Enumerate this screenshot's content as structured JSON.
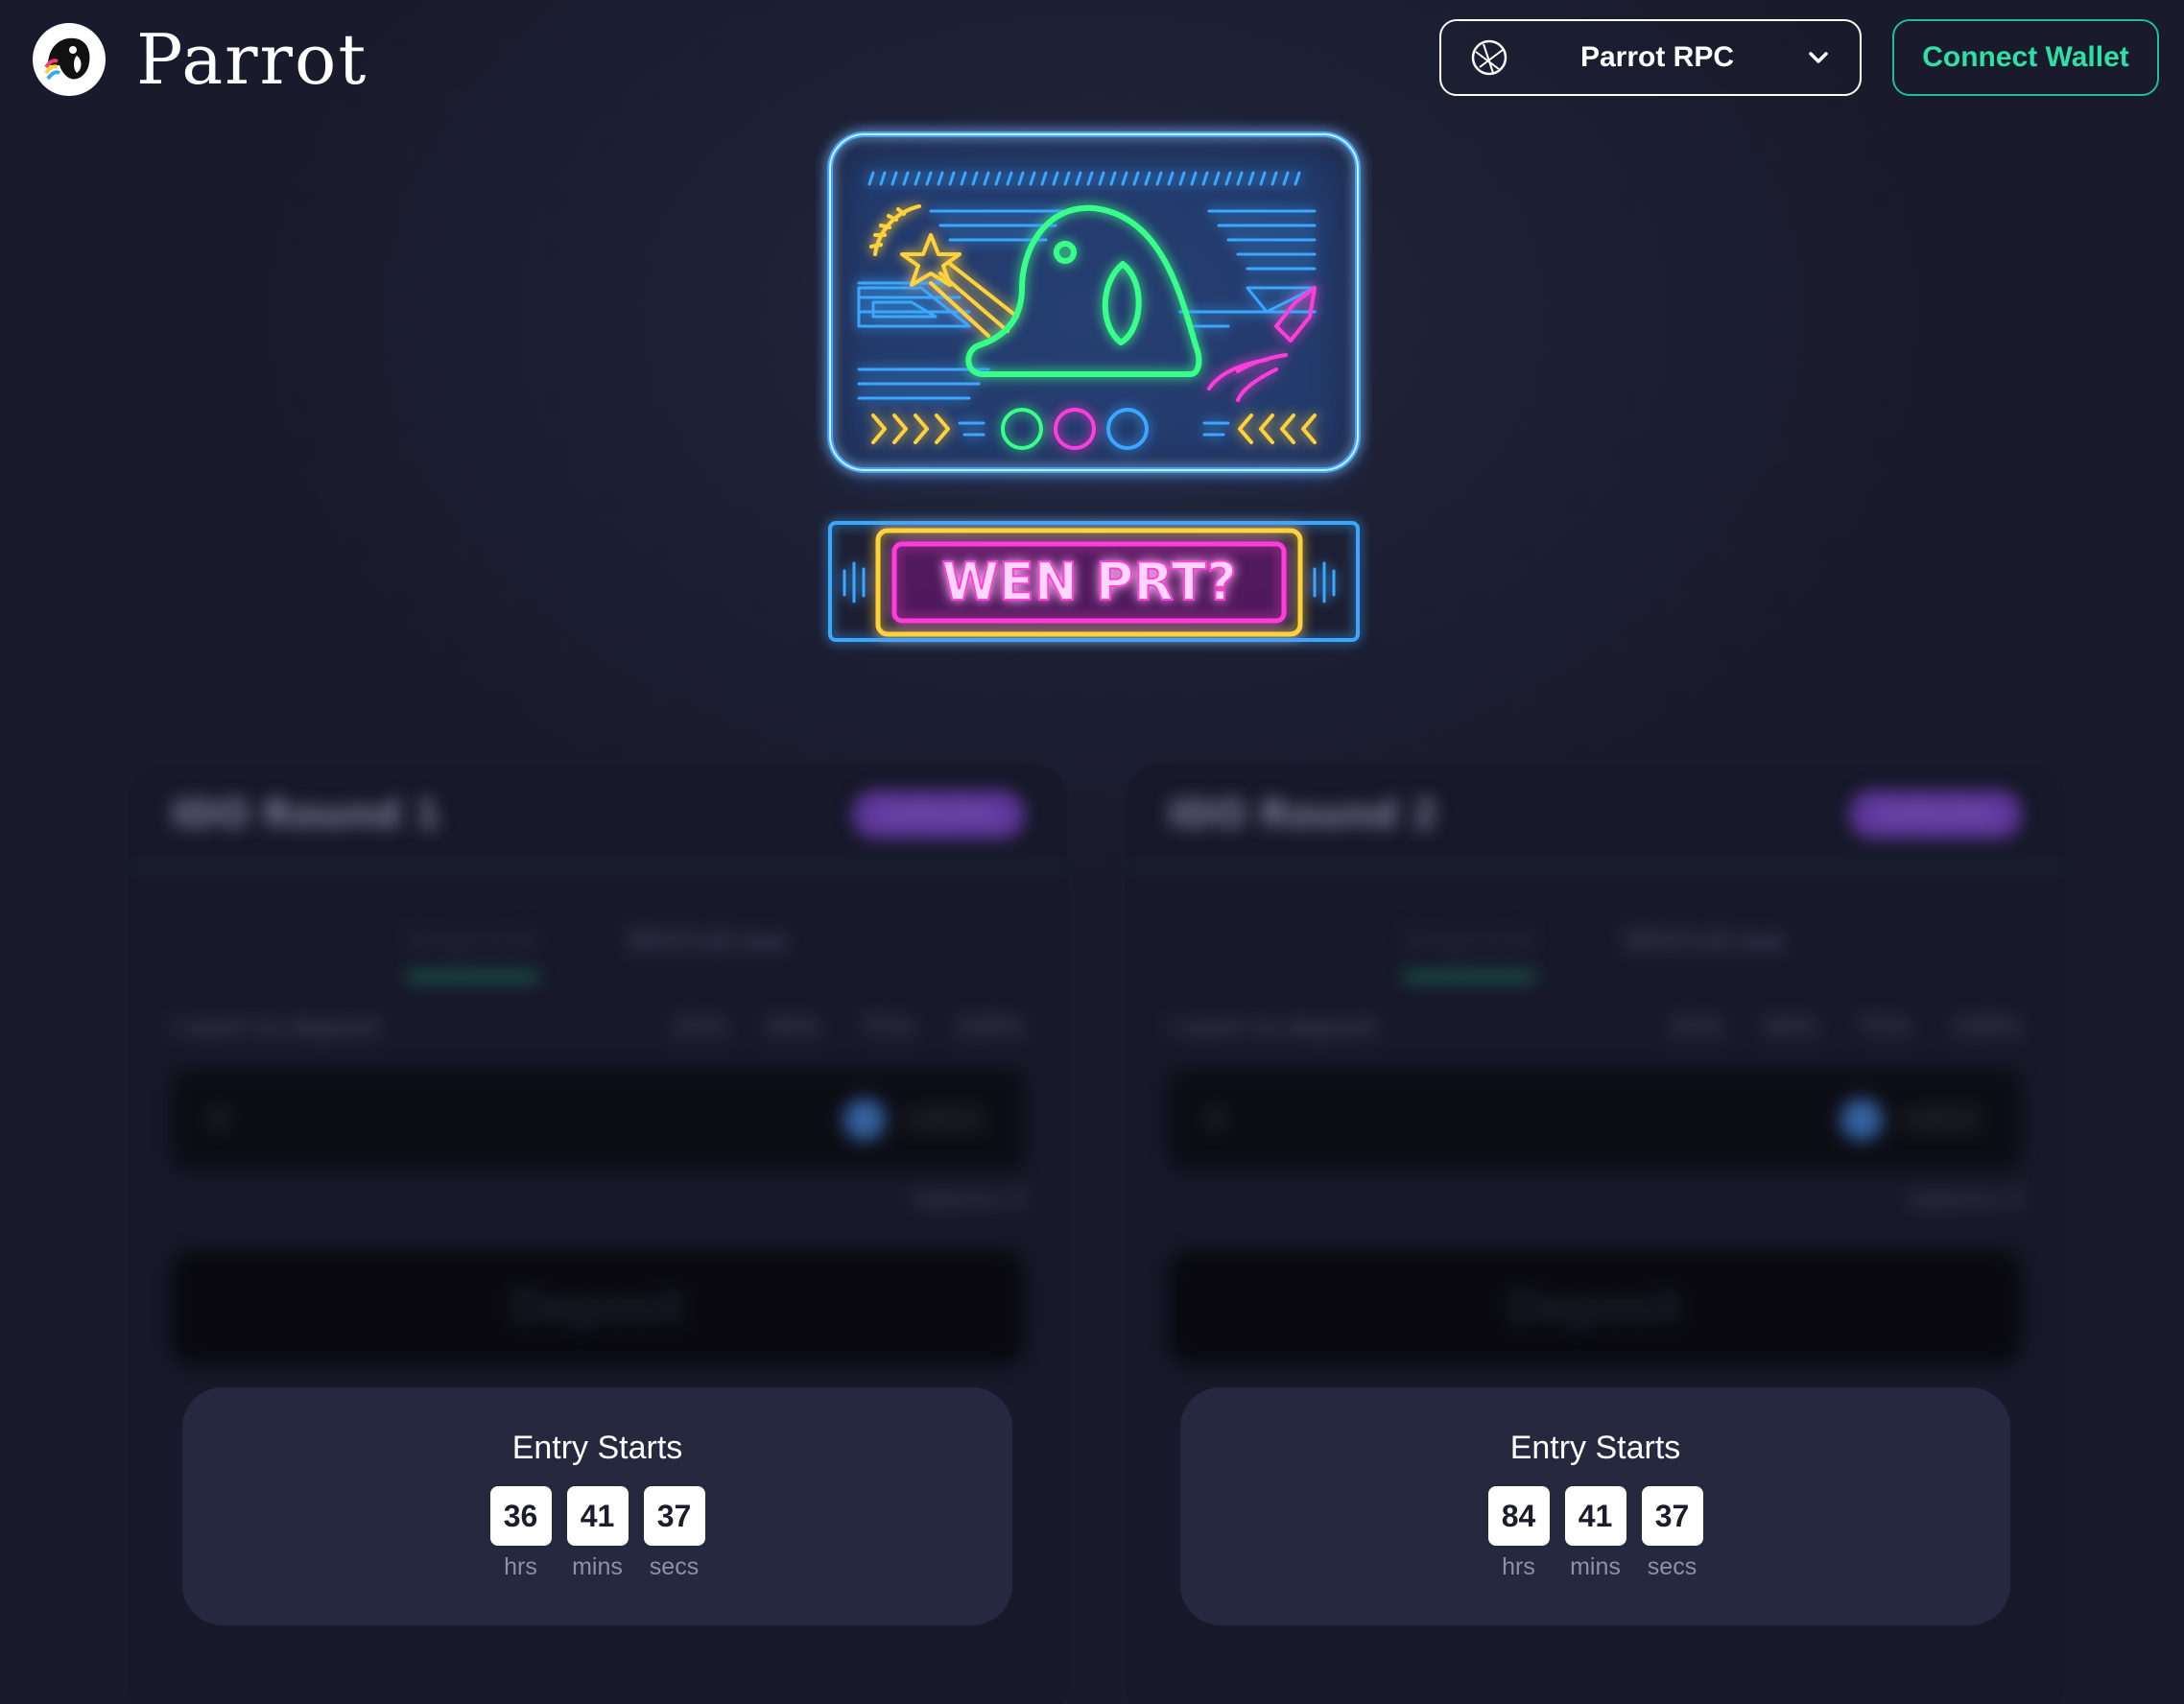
{
  "header": {
    "brand": "Parrot",
    "rpc_label": "Parrot RPC",
    "connect_label": "Connect Wallet"
  },
  "hero": {
    "banner_text": "WEN PRT?"
  },
  "rounds": [
    {
      "title": "IDO Round 1",
      "badge": "Coming Soon",
      "tabs": [
        "Deposit",
        "Withdraw"
      ],
      "deposit_prompt": "I want to deposit",
      "percent_options": [
        "25%",
        "50%",
        "75%",
        "100%"
      ],
      "amount_value": "0",
      "token": "USDC",
      "balance": "balance: 0 ",
      "action_label": "Deposit",
      "entry_title": "Entry Starts",
      "countdown": {
        "hrs": "36",
        "mins": "41",
        "secs": "37"
      },
      "units": {
        "hrs": "hrs",
        "mins": "mins",
        "secs": "secs"
      }
    },
    {
      "title": "IDO Round 2",
      "badge": "Coming Soon",
      "tabs": [
        "Deposit",
        "Withdraw"
      ],
      "deposit_prompt": "I want to deposit",
      "percent_options": [
        "25%",
        "50%",
        "75%",
        "100%"
      ],
      "amount_value": "0",
      "token": "USDC",
      "balance": "balance: 0 ",
      "action_label": "Deposit",
      "entry_title": "Entry Starts",
      "countdown": {
        "hrs": "84",
        "mins": "41",
        "secs": "37"
      },
      "units": {
        "hrs": "hrs",
        "mins": "mins",
        "secs": "secs"
      }
    }
  ],
  "colors": {
    "accent_green": "#2ee0a5",
    "neon_blue": "#3aa7ff",
    "neon_green": "#39ff8a",
    "neon_pink": "#ff3cd8",
    "neon_yellow": "#ffd23a"
  }
}
